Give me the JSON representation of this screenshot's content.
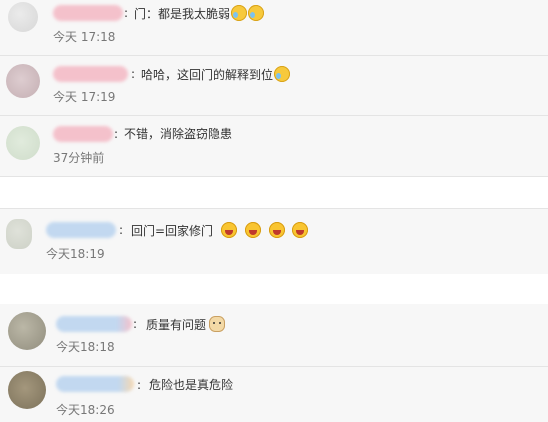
{
  "comments": [
    {
      "colon": ":",
      "text": "门：都是我太脆弱",
      "emojis": [
        "cry-laugh-emoji",
        "cry-laugh-emoji"
      ],
      "time": "今天 17:18"
    },
    {
      "colon": ":",
      "text": "哈哈，这回门的解释到位",
      "emojis": [
        "cry-laugh-emoji"
      ],
      "time": "今天 17:19"
    },
    {
      "colon": ":",
      "text": "不错，消除盗窃隐患",
      "emojis": [],
      "time": "37分钟前"
    },
    {
      "colon": ":",
      "text": "回门=回家修门",
      "emojis": [
        "laugh-emoji",
        "laugh-emoji",
        "laugh-emoji",
        "laugh-emoji"
      ],
      "time": "今天18:19"
    },
    {
      "colon": ":",
      "text": "质量有问题",
      "emojis": [
        "doge-emoji"
      ],
      "time": "今天18:18"
    },
    {
      "colon": ":",
      "text": "危险也是真危险",
      "emojis": [],
      "time": "今天18:26"
    }
  ],
  "colors": {
    "name_blur_pink": "#f4b8c4",
    "name_blur_blue": "#b9d3ef",
    "section_gap": "#f7f7f7"
  }
}
